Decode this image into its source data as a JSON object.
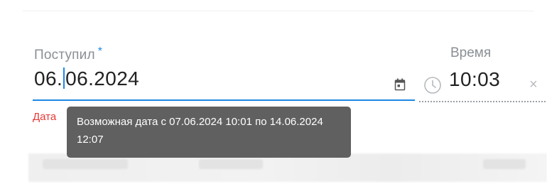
{
  "date_field": {
    "label": "Поступил",
    "required_mark": "*",
    "value_before_caret": "06.",
    "value_after_caret": "06.2024",
    "error_text": "Дата"
  },
  "time_field": {
    "label": "Время",
    "value": "10:03",
    "clear_symbol": "×"
  },
  "tooltip": {
    "text": "Возможная дата с 07.06.2024 10:01 по 14.06.2024 12:07"
  },
  "icons": {
    "calendar": "calendar-icon",
    "clock": "clock-icon",
    "clear": "close-icon"
  },
  "colors": {
    "accent": "#1e88e5",
    "error": "#e53935",
    "tooltip_bg": "#5a5a5a"
  }
}
